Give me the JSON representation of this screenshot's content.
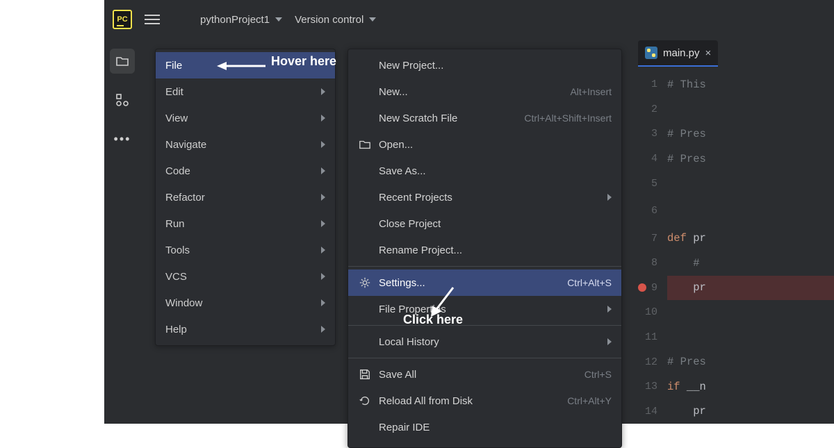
{
  "titlebar": {
    "logo_text": "PC",
    "project_name": "pythonProject1",
    "vcs_label": "Version control"
  },
  "main_menu": {
    "items": [
      {
        "label": "File",
        "has_sub": false,
        "selected": true
      },
      {
        "label": "Edit",
        "has_sub": true
      },
      {
        "label": "View",
        "has_sub": true
      },
      {
        "label": "Navigate",
        "has_sub": true
      },
      {
        "label": "Code",
        "has_sub": true
      },
      {
        "label": "Refactor",
        "has_sub": true
      },
      {
        "label": "Run",
        "has_sub": true
      },
      {
        "label": "Tools",
        "has_sub": true
      },
      {
        "label": "VCS",
        "has_sub": true
      },
      {
        "label": "Window",
        "has_sub": true
      },
      {
        "label": "Help",
        "has_sub": true
      }
    ]
  },
  "file_menu": {
    "groups": [
      [
        {
          "label": "New Project...",
          "icon": null,
          "shortcut": "",
          "sub": false
        },
        {
          "label": "New...",
          "icon": null,
          "shortcut": "Alt+Insert",
          "sub": false
        },
        {
          "label": "New Scratch File",
          "icon": null,
          "shortcut": "Ctrl+Alt+Shift+Insert",
          "sub": false
        },
        {
          "label": "Open...",
          "icon": "folder",
          "shortcut": "",
          "sub": false
        },
        {
          "label": "Save As...",
          "icon": null,
          "shortcut": "",
          "sub": false
        },
        {
          "label": "Recent Projects",
          "icon": null,
          "shortcut": "",
          "sub": true
        },
        {
          "label": "Close Project",
          "icon": null,
          "shortcut": "",
          "sub": false
        },
        {
          "label": "Rename Project...",
          "icon": null,
          "shortcut": "",
          "sub": false
        }
      ],
      [
        {
          "label": "Settings...",
          "icon": "gear",
          "shortcut": "Ctrl+Alt+S",
          "sub": false,
          "selected": true
        },
        {
          "label": "File Properties",
          "icon": null,
          "shortcut": "",
          "sub": true
        }
      ],
      [
        {
          "label": "Local History",
          "icon": null,
          "shortcut": "",
          "sub": true
        }
      ],
      [
        {
          "label": "Save All",
          "icon": "save",
          "shortcut": "Ctrl+S",
          "sub": false
        },
        {
          "label": "Reload All from Disk",
          "icon": "reload",
          "shortcut": "Ctrl+Alt+Y",
          "sub": false
        },
        {
          "label": "Repair IDE",
          "icon": null,
          "shortcut": "",
          "sub": false
        }
      ]
    ]
  },
  "editor": {
    "tab_filename": "main.py",
    "lines": [
      {
        "n": 1,
        "kind": "cmt",
        "text": "# This"
      },
      {
        "n": 2,
        "kind": "",
        "text": ""
      },
      {
        "n": 3,
        "kind": "cmt",
        "text": "# Pres"
      },
      {
        "n": 4,
        "kind": "cmt",
        "text": "# Pres"
      },
      {
        "n": 5,
        "kind": "",
        "text": ""
      },
      {
        "n": 6,
        "kind": "",
        "text": "",
        "gap": true
      },
      {
        "n": 7,
        "kind": "kw",
        "text": "def pr"
      },
      {
        "n": 8,
        "kind": "cmt",
        "text": "    # "
      },
      {
        "n": 9,
        "kind": "",
        "text": "    pr",
        "bp": true
      },
      {
        "n": 10,
        "kind": "",
        "text": ""
      },
      {
        "n": 11,
        "kind": "",
        "text": ""
      },
      {
        "n": 12,
        "kind": "cmt",
        "text": "# Pres"
      },
      {
        "n": 13,
        "kind": "kw",
        "text": "if __n"
      },
      {
        "n": 14,
        "kind": "",
        "text": "    pr"
      }
    ]
  },
  "annotations": {
    "hover": "Hover here",
    "click": "Click here"
  }
}
